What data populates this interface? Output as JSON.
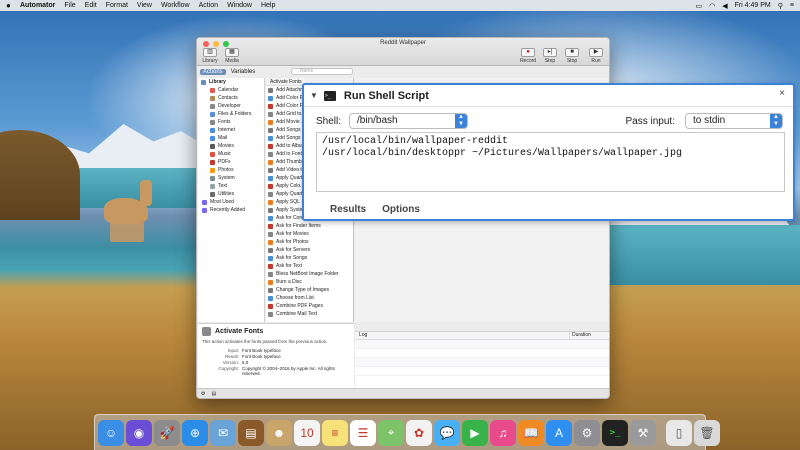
{
  "menubar": {
    "apple": "",
    "items": [
      "Automator",
      "File",
      "Edit",
      "Format",
      "View",
      "Workflow",
      "Action",
      "Window",
      "Help"
    ],
    "clock": "Fri 4:49 PM"
  },
  "window": {
    "title": "Reddit Wallpaper",
    "toolbar": {
      "library": "Library",
      "media": "Media",
      "record": "Record",
      "step": "Step",
      "stop": "Stop",
      "run": "Run"
    },
    "tabs": {
      "actions": "Actions",
      "variables": "Variables"
    },
    "search_placeholder": "Name",
    "library_header": "Library",
    "library_items": [
      {
        "label": "Calendar",
        "color": "#e25b4d"
      },
      {
        "label": "Contacts",
        "color": "#b08a55"
      },
      {
        "label": "Developer",
        "color": "#8a8a8a"
      },
      {
        "label": "Files & Folders",
        "color": "#5a8fd6"
      },
      {
        "label": "Fonts",
        "color": "#888888"
      },
      {
        "label": "Internet",
        "color": "#4a90d9"
      },
      {
        "label": "Mail",
        "color": "#4b8fe0"
      },
      {
        "label": "Movies",
        "color": "#5a5a5a"
      },
      {
        "label": "Music",
        "color": "#e0503d"
      },
      {
        "label": "PDFs",
        "color": "#c0392b"
      },
      {
        "label": "Photos",
        "color": "#f39c12"
      },
      {
        "label": "System",
        "color": "#7f8c8d"
      },
      {
        "label": "Text",
        "color": "#95a5a6"
      },
      {
        "label": "Utilities",
        "color": "#6b6b6b"
      }
    ],
    "extra_items": [
      {
        "label": "Most Used",
        "color": "#7b68ee"
      },
      {
        "label": "Recently Added",
        "color": "#7b68ee"
      }
    ],
    "actions_header": "Activate Fonts",
    "action_items": [
      "Add Attachm...",
      "Add Color P...",
      "Add Color P...",
      "Add Grid to...",
      "Add Movie ...",
      "Add Songs t...",
      "Add Songs t...",
      "Add to Album",
      "Add to Font...",
      "Add Thumbn...",
      "Add Video t...",
      "Apply Quart...",
      "Apply Colo...",
      "Apply Quart...",
      "Apply SQL",
      "Apply Syste...",
      "Ask for Conf...",
      "Ask for Finder Items",
      "Ask for Movies",
      "Ask for Photos",
      "Ask for Servers",
      "Ask for Songs",
      "Ask for Text",
      "Bless NetBoot Image Folder",
      "Burn a Disc",
      "Change Type of Images",
      "Choose from List",
      "Combine PDF Pages",
      "Combine Mail Text"
    ],
    "description": {
      "title": "Activate Fonts",
      "text": "This action activates the fonts passed from the previous action.",
      "fields": [
        {
          "key": "Input:",
          "value": "Font Book typeface"
        },
        {
          "key": "Result:",
          "value": "Font Book typeface"
        },
        {
          "key": "Version:",
          "value": "5.0"
        },
        {
          "key": "Copyright:",
          "value": "Copyright © 2004–2016 by Apple Inc. All rights reserved."
        }
      ]
    },
    "log": {
      "col_log": "Log",
      "col_duration": "Duration"
    }
  },
  "action": {
    "title": "Run Shell Script",
    "shell_label": "Shell:",
    "shell_value": "/bin/bash",
    "pass_label": "Pass input:",
    "pass_value": "to stdin",
    "script": "/usr/local/bin/wallpaper-reddit\n/usr/local/bin/desktoppr ~/Pictures/Wallpapers/wallpaper.jpg",
    "tabs": [
      "Results",
      "Options"
    ]
  },
  "dock": {
    "apps": [
      {
        "name": "finder-icon",
        "color": "#3a8ee6",
        "glyph": "☺"
      },
      {
        "name": "siri-icon",
        "color": "#6a4fd6",
        "glyph": "◉"
      },
      {
        "name": "launchpad-icon",
        "color": "#8c8c8c",
        "glyph": "🚀"
      },
      {
        "name": "safari-icon",
        "color": "#2b8de8",
        "glyph": "⊕"
      },
      {
        "name": "mail-stamp-icon",
        "color": "#6aa3d8",
        "glyph": "✉"
      },
      {
        "name": "notes-brown-icon",
        "color": "#8b5a2b",
        "glyph": "▤"
      },
      {
        "name": "contacts-icon",
        "color": "#c9a46b",
        "glyph": "☻"
      },
      {
        "name": "calendar-icon",
        "color": "#f4f4f4",
        "glyph": "10"
      },
      {
        "name": "notes-icon",
        "color": "#f7e27a",
        "glyph": "≡"
      },
      {
        "name": "reminders-icon",
        "color": "#ffffff",
        "glyph": "☰"
      },
      {
        "name": "maps-icon",
        "color": "#7cc36a",
        "glyph": "⌖"
      },
      {
        "name": "photos-icon",
        "color": "#f2f2f2",
        "glyph": "✿"
      },
      {
        "name": "messages-icon",
        "color": "#4ab0f5",
        "glyph": "💬"
      },
      {
        "name": "facetime-icon",
        "color": "#37b34a",
        "glyph": "▶"
      },
      {
        "name": "itunes-icon",
        "color": "#e84a8c",
        "glyph": "♫"
      },
      {
        "name": "ibooks-icon",
        "color": "#f08a24",
        "glyph": "📖"
      },
      {
        "name": "app-store-icon",
        "color": "#2f8ff0",
        "glyph": "A"
      },
      {
        "name": "system-preferences-icon",
        "color": "#8e8e93",
        "glyph": "⚙"
      },
      {
        "name": "terminal-icon",
        "color": "#222222",
        "glyph": ">_"
      },
      {
        "name": "automator-icon",
        "color": "#9a9a9a",
        "glyph": "⚒"
      }
    ],
    "docs": [
      {
        "name": "document-icon",
        "color": "#e8e8e8",
        "glyph": "▯"
      },
      {
        "name": "trash-icon",
        "color": "#d9d9d9",
        "glyph": "🗑"
      }
    ],
    "calendar_day": "10"
  }
}
